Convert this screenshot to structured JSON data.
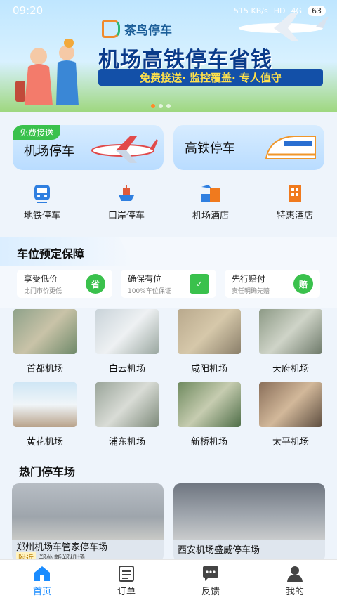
{
  "status": {
    "time": "09:20",
    "network": "515 KB/s",
    "hd": "HD",
    "signal": "4G",
    "battery": "63"
  },
  "banner": {
    "brand": "茶鸟停车",
    "slogan": "机场高铁停车省钱",
    "bar_text": "免费接送· 监控覆盖· 专人值守",
    "dots": 3,
    "active_dot": 0
  },
  "main_cards": [
    {
      "label": "机场停车",
      "tag": "免费接送",
      "icon": "airplane-icon"
    },
    {
      "label": "高铁停车",
      "tag": "",
      "icon": "train-icon"
    }
  ],
  "quick": [
    {
      "label": "地铁停车",
      "icon": "subway-icon",
      "color": "#2f7fe0"
    },
    {
      "label": "口岸停车",
      "icon": "port-icon",
      "color": "#e05a3a"
    },
    {
      "label": "机场酒店",
      "icon": "airport-hotel-icon",
      "color": "#2f7fe0"
    },
    {
      "label": "特惠酒店",
      "icon": "hotel-icon",
      "color": "#f07a1e"
    }
  ],
  "guarantee": {
    "title": "车位预定保障",
    "items": [
      {
        "title": "享受低价",
        "sub": "比门市价更低",
        "icon_text": "省",
        "color": "#3ac14c"
      },
      {
        "title": "确保有位",
        "sub": "100%车位保证",
        "icon_text": "✓",
        "color": "#3ac14c"
      },
      {
        "title": "先行赔付",
        "sub": "责任明确先赔",
        "icon_text": "赔",
        "color": "#3ac14c"
      }
    ]
  },
  "airports": [
    {
      "name": "首都机场"
    },
    {
      "name": "白云机场"
    },
    {
      "name": "咸阳机场"
    },
    {
      "name": "天府机场"
    },
    {
      "name": "黄花机场"
    },
    {
      "name": "浦东机场"
    },
    {
      "name": "新桥机场"
    },
    {
      "name": "太平机场"
    }
  ],
  "hot": {
    "title": "热门停车场",
    "lots": [
      {
        "name": "郑州机场车管家停车场",
        "badge": "附近",
        "location": "郑州新郑机场"
      },
      {
        "name": "西安机场盛威停车场",
        "badge": "",
        "location": ""
      }
    ]
  },
  "nav": [
    {
      "label": "首页",
      "icon": "home-icon",
      "active": true
    },
    {
      "label": "订单",
      "icon": "orders-icon",
      "active": false
    },
    {
      "label": "反馈",
      "icon": "feedback-icon",
      "active": false
    },
    {
      "label": "我的",
      "icon": "profile-icon",
      "active": false
    }
  ]
}
